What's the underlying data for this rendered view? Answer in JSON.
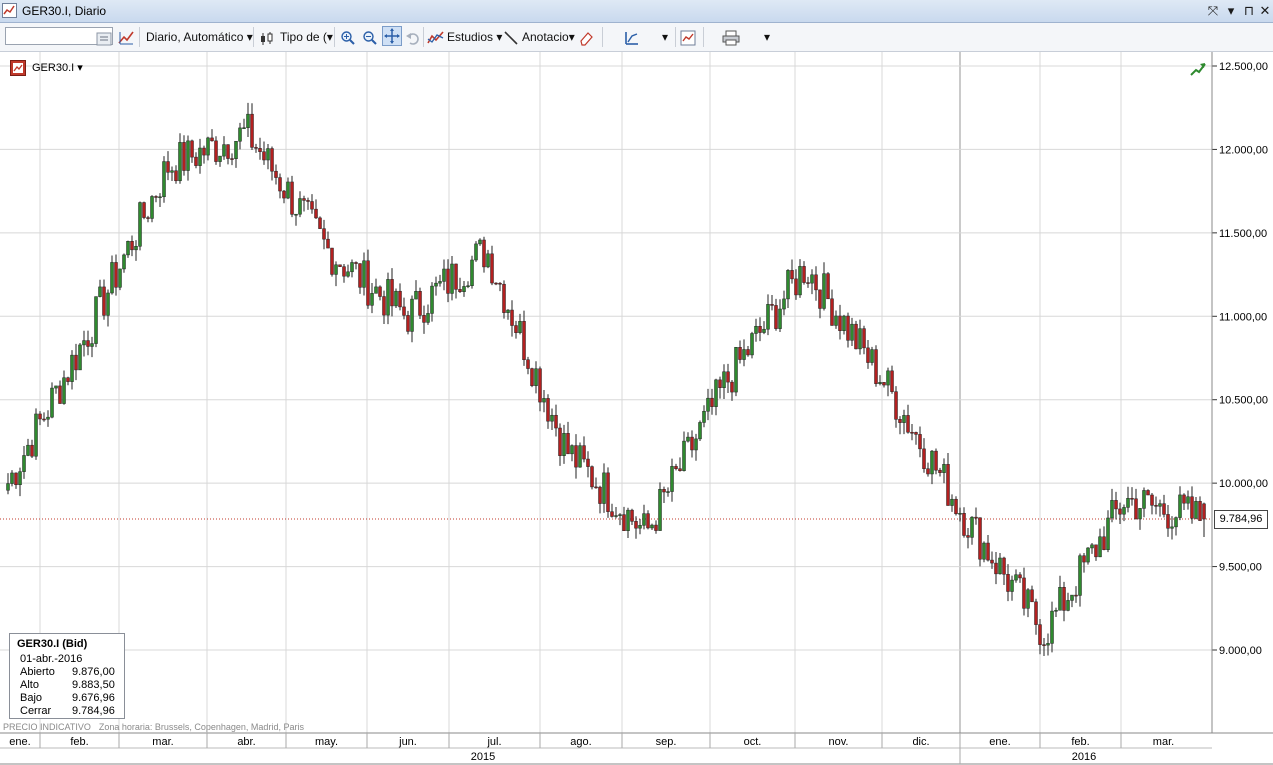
{
  "window": {
    "title": "GER30.I, Diario",
    "controls": [
      "⤧",
      "▾",
      "⊓",
      "✕"
    ]
  },
  "toolbar": {
    "symbol_placeholder": "",
    "period_label": "Diario,  Automático",
    "chart_type_label": "Tipo de (",
    "studies_label": "Estudios",
    "annotation_label": "Anotacio"
  },
  "chart": {
    "symbol": "GER30.I",
    "current_price_label": "9.784,96",
    "price_labels": [
      "12.500,00",
      "12.000,00",
      "11.500,00",
      "11.000,00",
      "10.500,00",
      "10.000,00",
      "9.500,00",
      "9.000,00"
    ],
    "months": [
      "ene.",
      "feb.",
      "mar.",
      "abr.",
      "may.",
      "jun.",
      "jul.",
      "ago.",
      "sep.",
      "oct.",
      "nov.",
      "dic.",
      "ene.",
      "feb.",
      "mar."
    ],
    "years": [
      "2015",
      "2016"
    ],
    "colors": {
      "up": "#2f8a2f",
      "down": "#b32020",
      "grid": "#d8d8d8",
      "price_line": "#c0392b"
    }
  },
  "chart_data": {
    "type": "candlestick",
    "title": "GER30.I, Diario",
    "xlabel": "",
    "ylabel": "",
    "ylim": [
      8600,
      12600
    ],
    "price_ticks": [
      12500,
      12000,
      11500,
      11000,
      10500,
      10000,
      9500,
      9000
    ],
    "current_price": 9784.96,
    "x_months": [
      "ene. 2015",
      "feb. 2015",
      "mar. 2015",
      "abr. 2015",
      "may. 2015",
      "jun. 2015",
      "jul. 2015",
      "ago. 2015",
      "sep. 2015",
      "oct. 2015",
      "nov. 2015",
      "dic. 2015",
      "ene. 2016",
      "feb. 2016",
      "mar. 2016"
    ],
    "approx_trend_close": [
      10000,
      10900,
      11900,
      12100,
      11400,
      11000,
      11400,
      10200,
      9700,
      10600,
      11300,
      10600,
      9800,
      9100,
      9900,
      9784.96
    ],
    "last_bar": {
      "date": "01-abr.-2016",
      "open": 9876.0,
      "high": 9883.5,
      "low": 9676.96,
      "close": 9784.96
    }
  },
  "legend": {
    "title": "GER30.I (Bid)",
    "date": "01-abr.-2016",
    "rows": [
      {
        "key": "Abierto",
        "value": "9.876,00"
      },
      {
        "key": "Alto",
        "value": "9.883,50"
      },
      {
        "key": "Bajo",
        "value": "9.676,96"
      },
      {
        "key": "Cerrar",
        "value": "9.784,96"
      }
    ]
  },
  "footer": {
    "note": "PRECIO INDICATIVO",
    "timezone": "Zona horaria: Brussels, Copenhagen, Madrid, Paris"
  }
}
